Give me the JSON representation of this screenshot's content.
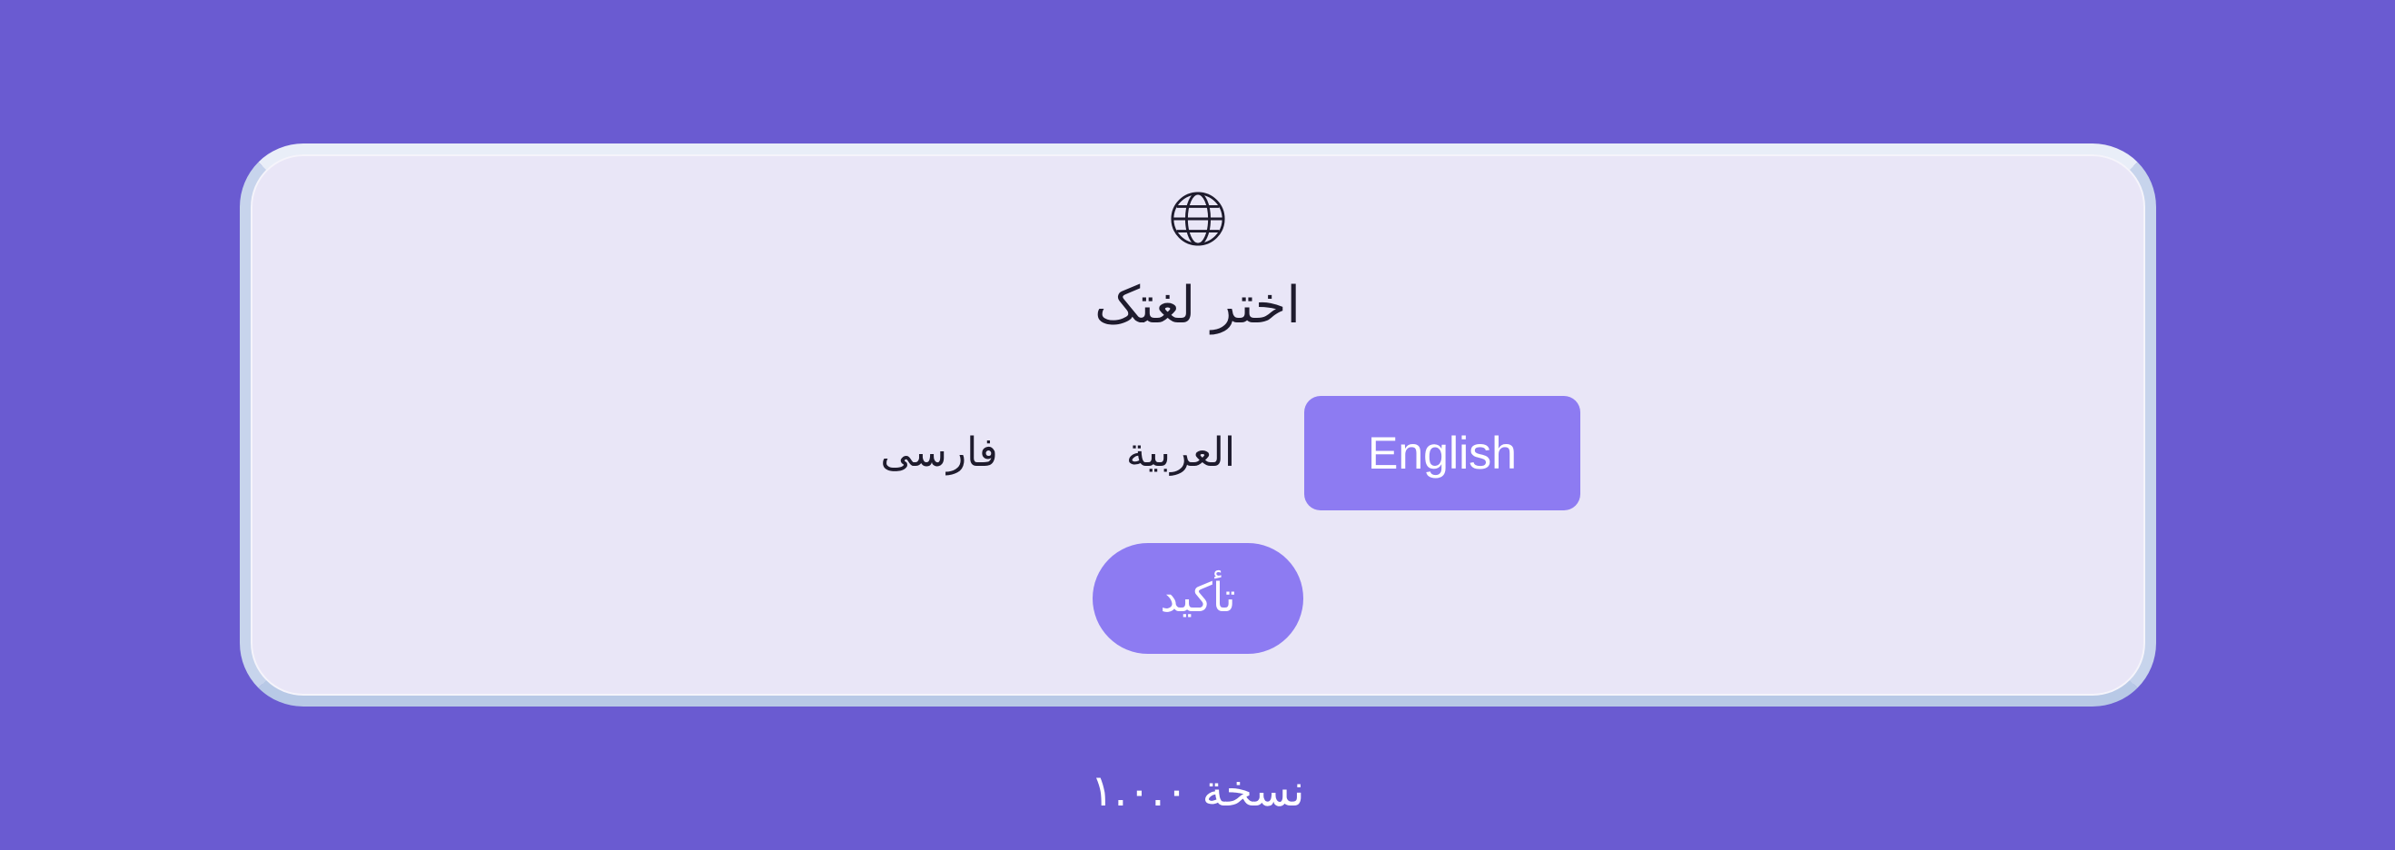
{
  "dialog": {
    "title": "اختر لغتک",
    "icon": "globe-icon",
    "languages": [
      {
        "label": "English",
        "selected": true
      },
      {
        "label": "العربية",
        "selected": false
      },
      {
        "label": "فارسی",
        "selected": false
      }
    ],
    "confirm_label": "تأکید"
  },
  "footer": {
    "version": "نسخة ١.٠.٠"
  },
  "colors": {
    "background": "#6a5bd1",
    "card": "#e9e6f7",
    "accent": "#8d7bf2",
    "text": "#1e1b2d"
  }
}
